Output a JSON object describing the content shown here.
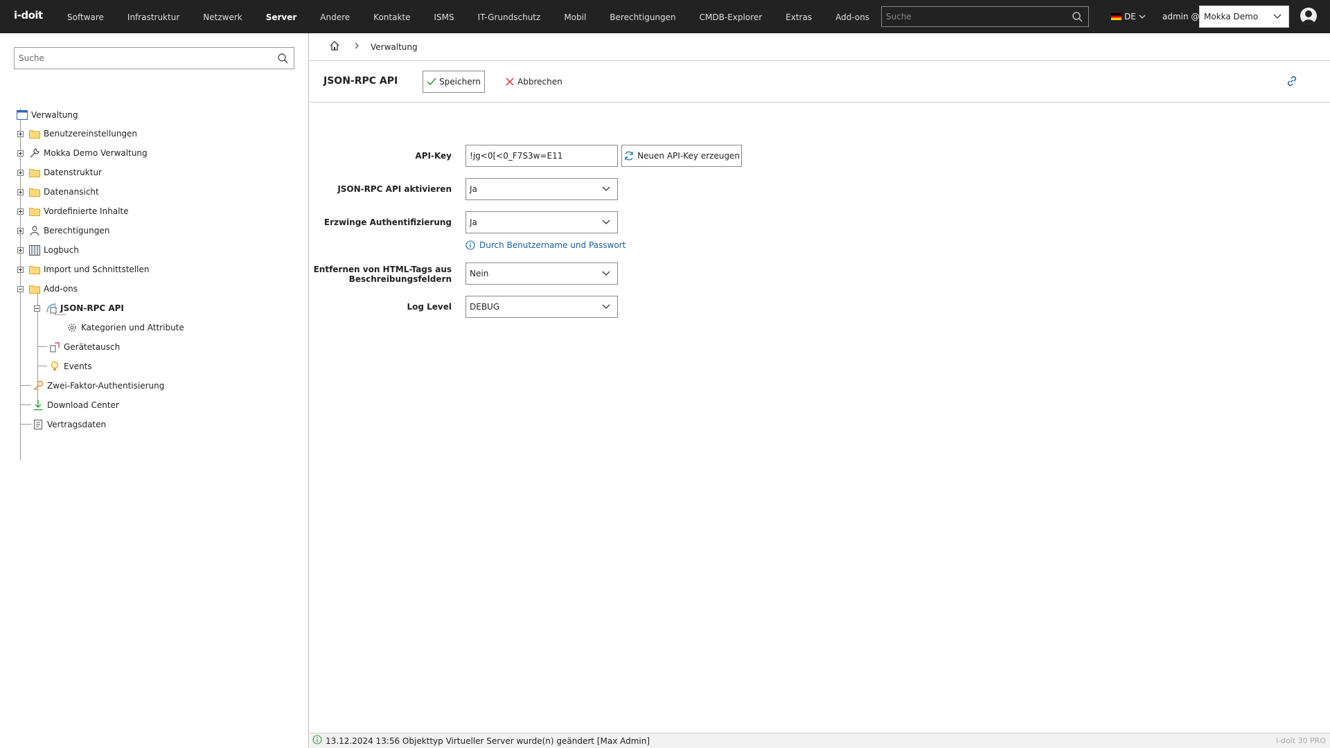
{
  "app": {
    "logo_text": "i-doit"
  },
  "nav": {
    "items": [
      {
        "label": "Software"
      },
      {
        "label": "Infrastruktur"
      },
      {
        "label": "Netzwerk"
      },
      {
        "label": "Server"
      },
      {
        "label": "Andere"
      },
      {
        "label": "Kontakte"
      },
      {
        "label": "ISMS"
      },
      {
        "label": "IT-Grundschutz"
      },
      {
        "label": "Mobil"
      },
      {
        "label": "Berechtigungen"
      },
      {
        "label": "CMDB-Explorer"
      },
      {
        "label": "Extras"
      },
      {
        "label": "Add-ons"
      }
    ],
    "active": "Server"
  },
  "top_search": {
    "placeholder": "Suche"
  },
  "language": {
    "code": "DE"
  },
  "user": {
    "label": "admin @",
    "tenant": "Mokka Demo"
  },
  "sidebar": {
    "search_placeholder": "Suche",
    "root": "Verwaltung",
    "items": [
      {
        "label": "Benutzereinstellungen",
        "icon": "folder-icon"
      },
      {
        "label": "Mokka Demo Verwaltung",
        "icon": "wrench-icon"
      },
      {
        "label": "Datenstruktur",
        "icon": "folder-icon"
      },
      {
        "label": "Datenansicht",
        "icon": "folder-icon"
      },
      {
        "label": "Vordefinierte Inhalte",
        "icon": "folder-icon"
      },
      {
        "label": "Berechtigungen",
        "icon": "users-icon"
      },
      {
        "label": "Logbuch",
        "icon": "book-icon"
      },
      {
        "label": "Import und Schnittstellen",
        "icon": "folder-icon"
      },
      {
        "label": "Add-ons",
        "icon": "folder-icon"
      },
      {
        "label": "JSON-RPC API",
        "icon": "api-icon"
      },
      {
        "label": "Kategorien und Attribute",
        "icon": "gear-icon"
      },
      {
        "label": "Gerätetausch",
        "icon": "swap-icon"
      },
      {
        "label": "Events",
        "icon": "bulb-icon"
      },
      {
        "label": "Zwei-Faktor-Authentisierung",
        "icon": "key-icon"
      },
      {
        "label": "Download Center",
        "icon": "download-icon"
      },
      {
        "label": "Vertragsdaten",
        "icon": "contract-icon"
      }
    ]
  },
  "breadcrumb": {
    "current": "Verwaltung"
  },
  "page": {
    "title": "JSON-RPC API",
    "save_label": "Speichern",
    "cancel_label": "Abbrechen"
  },
  "form": {
    "api_key_label": "API-Key",
    "api_key_value": "!jg<0[<0_F7S3w=E11",
    "new_key_label": "Neuen API-Key erzeugen",
    "activate_label": "JSON-RPC API aktivieren",
    "activate_value": "Ja",
    "force_auth_label": "Erzwinge Authentifizierung",
    "force_auth_value": "Ja",
    "auth_hint": "Durch Benutzername und Passwort",
    "strip_html_label_1": "Entfernen von HTML-Tags aus",
    "strip_html_label_2": "Beschreibungsfeldern",
    "strip_html_value": "Nein",
    "log_level_label": "Log Level",
    "log_level_value": "DEBUG"
  },
  "status": {
    "message": "13.12.2024 13:56 Objekttyp Virtueller Server wurde(n) geändert [Max Admin]",
    "version": "i-doit 30 PRO"
  },
  "colors": {
    "topbar": "#222222",
    "link": "#1a5fa8",
    "save_check": "#2a9d3a",
    "cancel_x": "#d9302c"
  }
}
